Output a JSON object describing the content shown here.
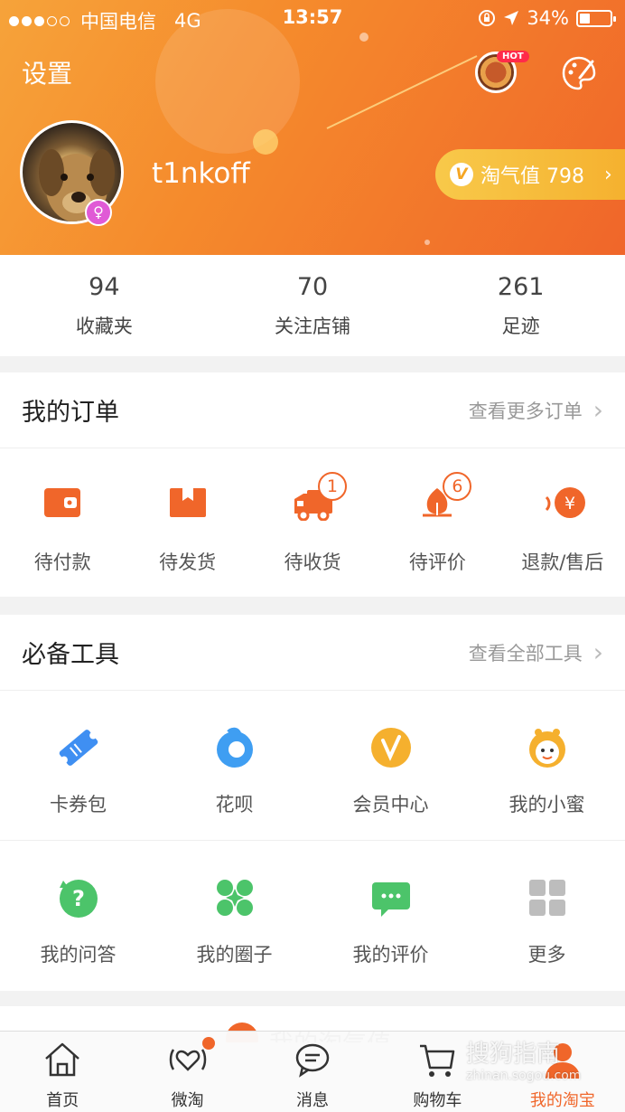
{
  "status_bar": {
    "carrier": "中国电信",
    "network": "4G",
    "time": "13:57",
    "battery": "34%",
    "battery_level": 0.34
  },
  "header": {
    "settings_label": "设置",
    "hot_badge": "HOT",
    "username": "t1nkoff",
    "gender_symbol": "♀",
    "taoqi_label": "淘气值 798",
    "taoqi_icon": "V",
    "chevron": "›"
  },
  "stats": [
    {
      "value": "94",
      "label": "收藏夹"
    },
    {
      "value": "70",
      "label": "关注店铺"
    },
    {
      "value": "261",
      "label": "足迹"
    }
  ],
  "orders": {
    "title": "我的订单",
    "more_label": "查看更多订单",
    "arrow": "›",
    "items": [
      {
        "label": "待付款",
        "icon": "wallet-icon",
        "badge": ""
      },
      {
        "label": "待发货",
        "icon": "package-icon",
        "badge": ""
      },
      {
        "label": "待收货",
        "icon": "truck-icon",
        "badge": "1"
      },
      {
        "label": "待评价",
        "icon": "review-icon",
        "badge": "6"
      },
      {
        "label": "退款/售后",
        "icon": "refund-icon",
        "badge": ""
      }
    ]
  },
  "tools": {
    "title": "必备工具",
    "more_label": "查看全部工具",
    "arrow": "›",
    "row1": [
      {
        "label": "卡券包",
        "icon": "coupon-icon"
      },
      {
        "label": "花呗",
        "icon": "huabei-icon"
      },
      {
        "label": "会员中心",
        "icon": "vip-icon"
      },
      {
        "label": "我的小蜜",
        "icon": "assistant-icon"
      }
    ],
    "row2": [
      {
        "label": "我的问答",
        "icon": "question-icon"
      },
      {
        "label": "我的圈子",
        "icon": "circle-icon"
      },
      {
        "label": "我的评价",
        "icon": "comment-icon"
      },
      {
        "label": "更多",
        "icon": "more-grid-icon"
      }
    ]
  },
  "peek_section": {
    "title": "我的淘气值"
  },
  "tabbar": [
    {
      "label": "首页",
      "icon": "home-icon",
      "active": false
    },
    {
      "label": "微淘",
      "icon": "weitao-icon",
      "active": false
    },
    {
      "label": "消息",
      "icon": "message-icon",
      "active": false
    },
    {
      "label": "购物车",
      "icon": "cart-icon",
      "active": false
    },
    {
      "label": "我的淘宝",
      "icon": "profile-icon",
      "active": true
    }
  ],
  "watermark": {
    "title": "搜狗指南",
    "url": "zhinan.sogou.com"
  },
  "colors": {
    "accent": "#f0662a",
    "header_start": "#f6a33a",
    "header_end": "#f0662a",
    "gold": "#f5b02e"
  }
}
